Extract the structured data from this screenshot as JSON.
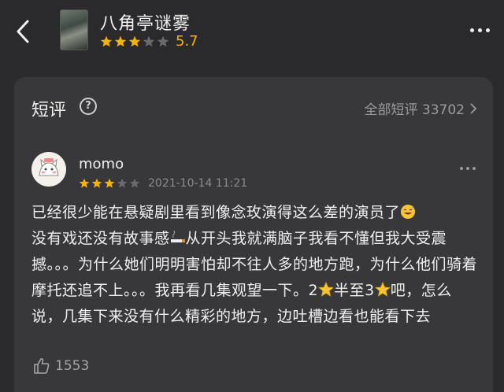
{
  "header": {
    "title": "八角亭谜雾",
    "score": "5.7",
    "rating_fraction": 0.6,
    "star_color": "#f5b400"
  },
  "section": {
    "title": "短评",
    "all_link": "全部短评 33702"
  },
  "review": {
    "username": "momo",
    "rating_fraction": 0.6,
    "date": "2021-10-14 11:21",
    "text_parts": [
      "已经很少能在悬疑剧里看到像念玫演得这么差的演员了",
      "没有戏还没有故事感",
      "从开头我就满脑子我看不懂但我大受震撼。。。为什么她们明明害怕却不往人多的地方跑，为什么他们骑着摩托还追不上。。。我再看几集观望一下。2",
      "半至3",
      "吧，怎么说，几集下来没有什么精彩的地方，边吐槽边看也能看下去"
    ],
    "likes": "1553"
  },
  "icons": {
    "back": "back-arrow-icon",
    "more": "more-icon",
    "help": "help-icon",
    "like": "thumbs-up-icon"
  }
}
